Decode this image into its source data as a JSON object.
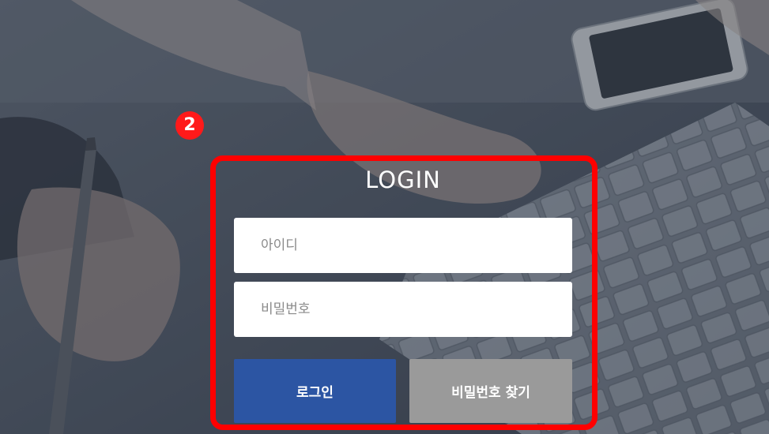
{
  "step_badge": "2",
  "login": {
    "title": "LOGIN",
    "id_placeholder": "아이디",
    "password_placeholder": "비밀번호",
    "login_button": "로그인",
    "find_password_button": "비밀번호 찾기"
  },
  "colors": {
    "login_button": "#2c55a3",
    "find_password_button": "#9a9a9a",
    "highlight": "#ff0000",
    "overlay": "#3f4755"
  }
}
